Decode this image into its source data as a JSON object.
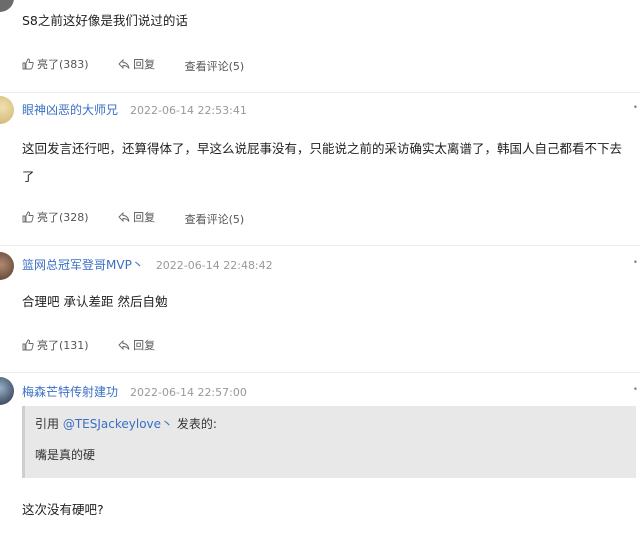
{
  "comments": [
    {
      "text": "S8之前这好像是我们说过的话",
      "likes": "亮了(383)",
      "reply": "回复",
      "view_replies": "查看评论(5)"
    },
    {
      "username": "眼神凶恶的大师兄",
      "time": "2022-06-14 22:53:41",
      "text": "这回发言还行吧，还算得体了，早这么说屁事没有，只能说之前的采访确实太离谱了，韩国人自己都看不下去了",
      "likes": "亮了(328)",
      "reply": "回复",
      "view_replies": "查看评论(5)"
    },
    {
      "username": "篮网总冠军登哥MVP丶",
      "time": "2022-06-14 22:48:42",
      "text": "合理吧 承认差距 然后自勉",
      "likes": "亮了(131)",
      "reply": "回复"
    },
    {
      "username": "梅森芒特传射建功",
      "time": "2022-06-14 22:57:00",
      "quote": {
        "prefix": "引用",
        "user": "@TESJackeylove丶",
        "suffix": "发表的:",
        "text": "嘴是真的硬"
      },
      "text": "这次没有硬吧?"
    }
  ],
  "colors": {
    "username": "#3a6fc4",
    "time": "#999999",
    "quote_bg": "#e8e8e8",
    "divider": "#ececec"
  }
}
